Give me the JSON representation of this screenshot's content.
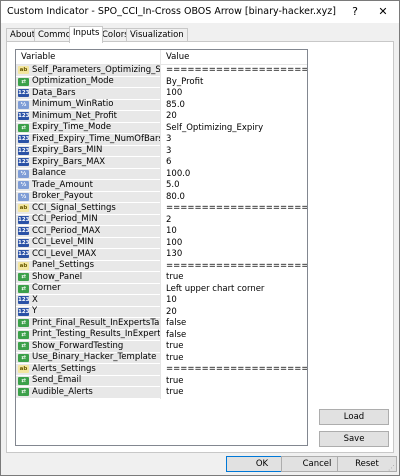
{
  "window": {
    "title": "Custom Indicator - SPO_CCI_In-Cross OBOS Arrow [binary-hacker.xyz]",
    "help": "?",
    "close": "✕"
  },
  "tabs": [
    {
      "label": "About"
    },
    {
      "label": "Common"
    },
    {
      "label": "Inputs"
    },
    {
      "label": "Colors"
    },
    {
      "label": "Visualization"
    }
  ],
  "grid": {
    "headers": {
      "variable": "Variable",
      "value": "Value"
    },
    "rows": [
      {
        "icon": "ab",
        "name": "Self_Parameters_Optimizing_Settings",
        "value": "================================="
      },
      {
        "icon": "enum",
        "name": "Optimization_Mode",
        "value": "By_Profit"
      },
      {
        "icon": "123",
        "name": "Data_Bars",
        "value": "100"
      },
      {
        "icon": "half",
        "name": "Minimum_WinRatio",
        "value": "85.0"
      },
      {
        "icon": "123",
        "name": "Minimum_Net_Profit",
        "value": "20"
      },
      {
        "icon": "enum",
        "name": "Expiry_Time_Mode",
        "value": "Self_Optimizing_Expiry"
      },
      {
        "icon": "123",
        "name": "Fixed_Expiry_Time_NumOfBars",
        "value": "3"
      },
      {
        "icon": "123",
        "name": "Expiry_Bars_MIN",
        "value": "3"
      },
      {
        "icon": "123",
        "name": "Expiry_Bars_MAX",
        "value": "6"
      },
      {
        "icon": "half",
        "name": "Balance",
        "value": "100.0"
      },
      {
        "icon": "half",
        "name": "Trade_Amount",
        "value": "5.0"
      },
      {
        "icon": "half",
        "name": "Broker_Payout",
        "value": "80.0"
      },
      {
        "icon": "ab",
        "name": "CCI_Signal_Settings",
        "value": "================================="
      },
      {
        "icon": "123",
        "name": "CCI_Period_MIN",
        "value": "2"
      },
      {
        "icon": "123",
        "name": "CCI_Period_MAX",
        "value": "10"
      },
      {
        "icon": "123",
        "name": "CCI_Level_MIN",
        "value": "100"
      },
      {
        "icon": "123",
        "name": "CCI_Level_MAX",
        "value": "130"
      },
      {
        "icon": "ab",
        "name": "Panel_Settings",
        "value": "================================="
      },
      {
        "icon": "bool",
        "name": "Show_Panel",
        "value": "true"
      },
      {
        "icon": "enum",
        "name": "Corner",
        "value": "Left upper chart corner"
      },
      {
        "icon": "123",
        "name": "X",
        "value": "10"
      },
      {
        "icon": "123",
        "name": "Y",
        "value": "20"
      },
      {
        "icon": "bool",
        "name": "Print_Final_Result_InExpertsTab",
        "value": "false"
      },
      {
        "icon": "bool",
        "name": "Print_Testing_Results_InExpertsTab",
        "value": "false"
      },
      {
        "icon": "bool",
        "name": "Show_ForwardTesting",
        "value": "true"
      },
      {
        "icon": "bool",
        "name": "Use_Binary_Hacker_Template",
        "value": "true"
      },
      {
        "icon": "ab",
        "name": "Alerts_Settings",
        "value": "================================="
      },
      {
        "icon": "bool",
        "name": "Send_Email",
        "value": "true"
      },
      {
        "icon": "bool",
        "name": "Audible_Alerts",
        "value": "true"
      }
    ]
  },
  "icon_text": {
    "ab": "ab",
    "123": "123",
    "half": "½",
    "bool": "⇄",
    "enum": "⇄"
  },
  "buttons": {
    "load": "Load",
    "save": "Save",
    "ok": "OK",
    "cancel": "Cancel",
    "reset": "Reset"
  }
}
